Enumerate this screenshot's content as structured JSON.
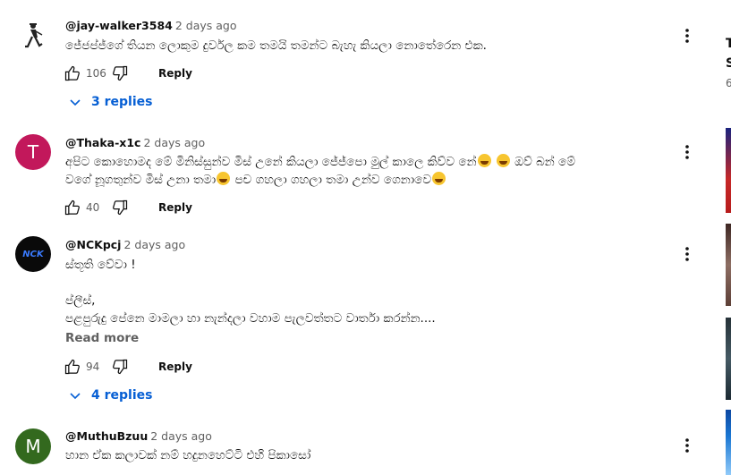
{
  "comments": [
    {
      "handle": "@jay-walker3584",
      "time": "2 days ago",
      "lines": [
        "ජේජප්ජ්ගේ තියන ලොකුම දුර්වල කම තමයි තමන්ට බැහැ කියලා නොතේරෙන එක."
      ],
      "likes": "106",
      "reply_label": "Reply",
      "replies_label": "3 replies"
    },
    {
      "handle": "@Thaka-x1c",
      "time": "2 days ago",
      "avatar_letter": "T",
      "avatar_color": "#c2185b",
      "lines": [
        "අපිට කොහොමද මේ මිනිස්සුන්ව මිස් උනේ කියලා ජේජ්පො මුල් කාලෙ කිව්ව නේ",
        "ඔව් බන් මේ",
        "වගේ නූගතුන්ව මිස් උනා තමා",
        "පච ගහලා ගහලා තමා උන්ව ගෙනාවෙ"
      ],
      "likes": "40",
      "reply_label": "Reply"
    },
    {
      "handle": "@NCKpcj",
      "time": "2 days ago",
      "avatar_text": "NCK",
      "lines": [
        "ස්තූති වේවා !",
        "ප්ලීස්,",
        "පළපුරුදු  පේනෙ මාමලා හා නැන්දලා වහාම පැලවත්තට වාර්තා කරන්න...."
      ],
      "read_more": "Read more",
      "likes": "94",
      "reply_label": "Reply",
      "replies_label": "4 replies"
    },
    {
      "handle": "@MuthuBzuu",
      "time": "2 days ago",
      "avatar_letter": "M",
      "avatar_color": "#33691e",
      "lines": [
        "හාන ඒක කලාවක් නම් හදුනහෙට්ටි එහි පිකාසෝ"
      ]
    }
  ],
  "sidebar": {
    "line1": "T",
    "line2": "S",
    "line3": "6"
  }
}
